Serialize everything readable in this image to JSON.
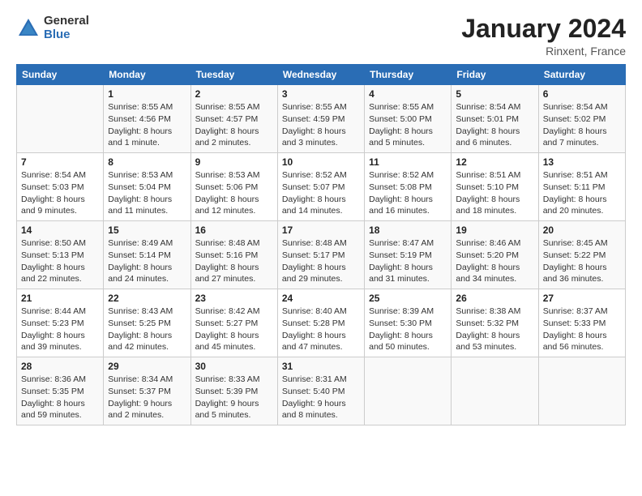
{
  "header": {
    "logo_general": "General",
    "logo_blue": "Blue",
    "title": "January 2024",
    "location": "Rinxent, France"
  },
  "days_of_week": [
    "Sunday",
    "Monday",
    "Tuesday",
    "Wednesday",
    "Thursday",
    "Friday",
    "Saturday"
  ],
  "weeks": [
    [
      {
        "day": "",
        "info": ""
      },
      {
        "day": "1",
        "info": "Sunrise: 8:55 AM\nSunset: 4:56 PM\nDaylight: 8 hours\nand 1 minute."
      },
      {
        "day": "2",
        "info": "Sunrise: 8:55 AM\nSunset: 4:57 PM\nDaylight: 8 hours\nand 2 minutes."
      },
      {
        "day": "3",
        "info": "Sunrise: 8:55 AM\nSunset: 4:59 PM\nDaylight: 8 hours\nand 3 minutes."
      },
      {
        "day": "4",
        "info": "Sunrise: 8:55 AM\nSunset: 5:00 PM\nDaylight: 8 hours\nand 5 minutes."
      },
      {
        "day": "5",
        "info": "Sunrise: 8:54 AM\nSunset: 5:01 PM\nDaylight: 8 hours\nand 6 minutes."
      },
      {
        "day": "6",
        "info": "Sunrise: 8:54 AM\nSunset: 5:02 PM\nDaylight: 8 hours\nand 7 minutes."
      }
    ],
    [
      {
        "day": "7",
        "info": "Sunrise: 8:54 AM\nSunset: 5:03 PM\nDaylight: 8 hours\nand 9 minutes."
      },
      {
        "day": "8",
        "info": "Sunrise: 8:53 AM\nSunset: 5:04 PM\nDaylight: 8 hours\nand 11 minutes."
      },
      {
        "day": "9",
        "info": "Sunrise: 8:53 AM\nSunset: 5:06 PM\nDaylight: 8 hours\nand 12 minutes."
      },
      {
        "day": "10",
        "info": "Sunrise: 8:52 AM\nSunset: 5:07 PM\nDaylight: 8 hours\nand 14 minutes."
      },
      {
        "day": "11",
        "info": "Sunrise: 8:52 AM\nSunset: 5:08 PM\nDaylight: 8 hours\nand 16 minutes."
      },
      {
        "day": "12",
        "info": "Sunrise: 8:51 AM\nSunset: 5:10 PM\nDaylight: 8 hours\nand 18 minutes."
      },
      {
        "day": "13",
        "info": "Sunrise: 8:51 AM\nSunset: 5:11 PM\nDaylight: 8 hours\nand 20 minutes."
      }
    ],
    [
      {
        "day": "14",
        "info": "Sunrise: 8:50 AM\nSunset: 5:13 PM\nDaylight: 8 hours\nand 22 minutes."
      },
      {
        "day": "15",
        "info": "Sunrise: 8:49 AM\nSunset: 5:14 PM\nDaylight: 8 hours\nand 24 minutes."
      },
      {
        "day": "16",
        "info": "Sunrise: 8:48 AM\nSunset: 5:16 PM\nDaylight: 8 hours\nand 27 minutes."
      },
      {
        "day": "17",
        "info": "Sunrise: 8:48 AM\nSunset: 5:17 PM\nDaylight: 8 hours\nand 29 minutes."
      },
      {
        "day": "18",
        "info": "Sunrise: 8:47 AM\nSunset: 5:19 PM\nDaylight: 8 hours\nand 31 minutes."
      },
      {
        "day": "19",
        "info": "Sunrise: 8:46 AM\nSunset: 5:20 PM\nDaylight: 8 hours\nand 34 minutes."
      },
      {
        "day": "20",
        "info": "Sunrise: 8:45 AM\nSunset: 5:22 PM\nDaylight: 8 hours\nand 36 minutes."
      }
    ],
    [
      {
        "day": "21",
        "info": "Sunrise: 8:44 AM\nSunset: 5:23 PM\nDaylight: 8 hours\nand 39 minutes."
      },
      {
        "day": "22",
        "info": "Sunrise: 8:43 AM\nSunset: 5:25 PM\nDaylight: 8 hours\nand 42 minutes."
      },
      {
        "day": "23",
        "info": "Sunrise: 8:42 AM\nSunset: 5:27 PM\nDaylight: 8 hours\nand 45 minutes."
      },
      {
        "day": "24",
        "info": "Sunrise: 8:40 AM\nSunset: 5:28 PM\nDaylight: 8 hours\nand 47 minutes."
      },
      {
        "day": "25",
        "info": "Sunrise: 8:39 AM\nSunset: 5:30 PM\nDaylight: 8 hours\nand 50 minutes."
      },
      {
        "day": "26",
        "info": "Sunrise: 8:38 AM\nSunset: 5:32 PM\nDaylight: 8 hours\nand 53 minutes."
      },
      {
        "day": "27",
        "info": "Sunrise: 8:37 AM\nSunset: 5:33 PM\nDaylight: 8 hours\nand 56 minutes."
      }
    ],
    [
      {
        "day": "28",
        "info": "Sunrise: 8:36 AM\nSunset: 5:35 PM\nDaylight: 8 hours\nand 59 minutes."
      },
      {
        "day": "29",
        "info": "Sunrise: 8:34 AM\nSunset: 5:37 PM\nDaylight: 9 hours\nand 2 minutes."
      },
      {
        "day": "30",
        "info": "Sunrise: 8:33 AM\nSunset: 5:39 PM\nDaylight: 9 hours\nand 5 minutes."
      },
      {
        "day": "31",
        "info": "Sunrise: 8:31 AM\nSunset: 5:40 PM\nDaylight: 9 hours\nand 8 minutes."
      },
      {
        "day": "",
        "info": ""
      },
      {
        "day": "",
        "info": ""
      },
      {
        "day": "",
        "info": ""
      }
    ]
  ]
}
